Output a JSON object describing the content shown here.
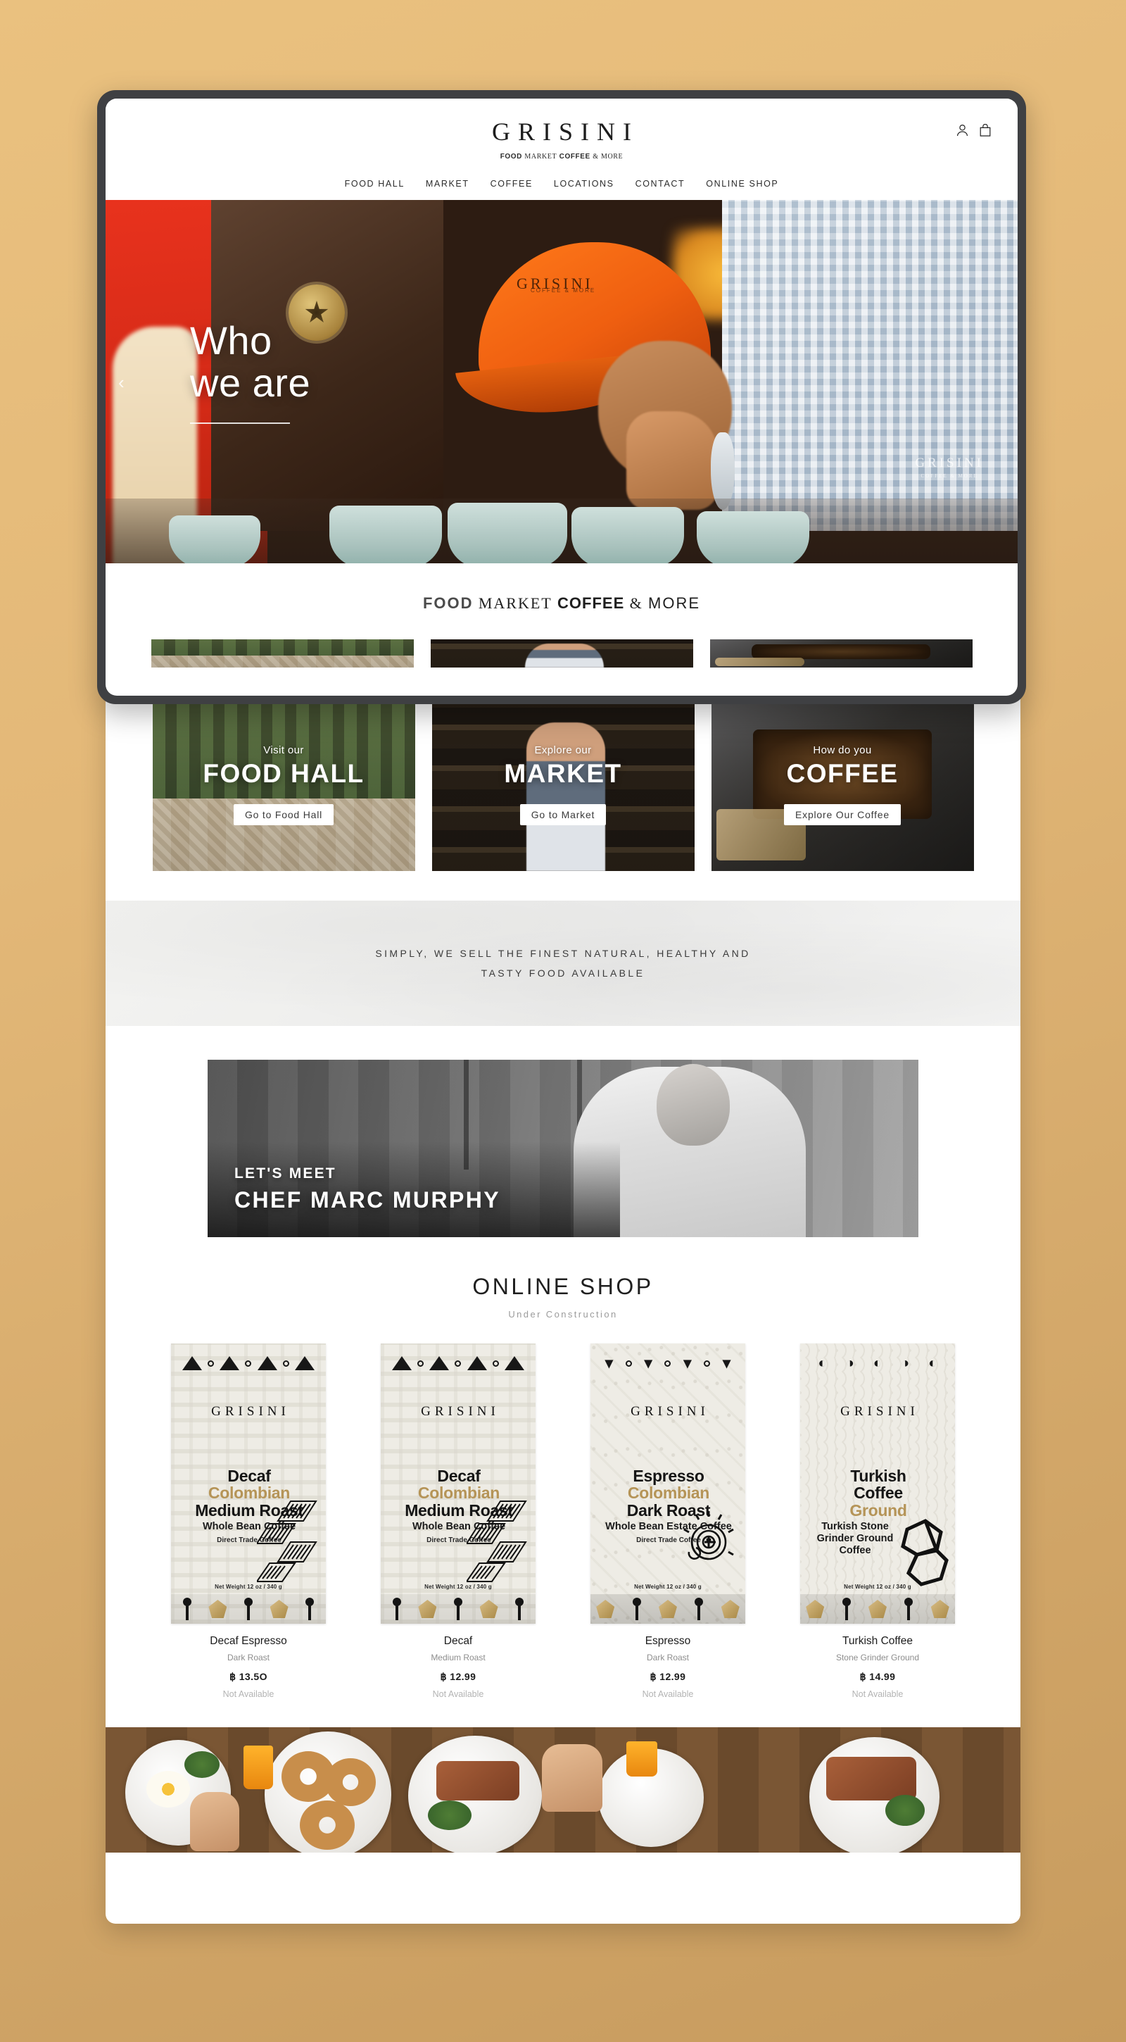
{
  "brand": {
    "logo": "GRISINI",
    "logo_letters": [
      "G",
      "R",
      "I",
      "S",
      "I",
      "N",
      "I"
    ],
    "tagline_parts": [
      {
        "text": "FOOD",
        "style": "bold"
      },
      {
        "text": "MARKET",
        "style": "serif"
      },
      {
        "text": "COFFEE",
        "style": "bold"
      },
      {
        "text": "&",
        "style": "serif"
      },
      {
        "text": "MORE",
        "style": "light"
      }
    ],
    "tagline_flat": "FOOD MARKET COFFEE & MORE"
  },
  "header": {
    "icons": [
      {
        "name": "account-icon",
        "label": "Account"
      },
      {
        "name": "shopping-bag-icon",
        "label": "Cart"
      }
    ],
    "nav": [
      {
        "label": "FOOD HALL"
      },
      {
        "label": "MARKET"
      },
      {
        "label": "COFFEE"
      },
      {
        "label": "LOCATIONS"
      },
      {
        "label": "CONTACT"
      },
      {
        "label": "ONLINE SHOP"
      }
    ]
  },
  "hero": {
    "line1": "Who",
    "line2": "we are",
    "prev_arrow": "‹",
    "cap_text": "GRISINI",
    "cap_sub": "COFFEE & MORE",
    "watermark": "GRISINI",
    "watermark_sub": "COFFEE & MORE"
  },
  "band_tagline": {
    "parts": [
      {
        "text": "FOOD",
        "style": "outline"
      },
      {
        "text": "MARKET",
        "style": "serif"
      },
      {
        "text": "COFFEE",
        "style": "bold"
      },
      {
        "text": "&",
        "style": "serif"
      },
      {
        "text": "MORE",
        "style": "light"
      }
    ]
  },
  "feature_cards": [
    {
      "kicker": "Visit our",
      "title": "FOOD HALL",
      "button": "Go to Food Hall",
      "photo": "food-hall-interior"
    },
    {
      "kicker": "Explore our",
      "title": "MARKET",
      "button": "Go to Market",
      "photo": "market-aisle-grocer"
    },
    {
      "kicker": "How do you",
      "title": "COFFEE",
      "button": "Explore Our Coffee",
      "photo": "coffee-roaster-beans"
    }
  ],
  "quote_band": {
    "line1": "SIMPLY, WE SELL THE FINEST NATURAL, HEALTHY AND",
    "line2": "TASTY FOOD AVAILABLE"
  },
  "chef_banner": {
    "kicker": "LET'S MEET",
    "name_part1": "C",
    "name": "CHEF MARC MURPHY",
    "photo": "chef-portrait-black-white"
  },
  "shop": {
    "title": "ONLINE SHOP",
    "subtitle": "Under Construction",
    "prev_arrow": "‹",
    "next_arrow": "›",
    "currency": "฿",
    "products": [
      {
        "name": "Decaf Espresso",
        "roast": "Dark Roast",
        "price": "฿ 13.5O",
        "stock": "Not Available",
        "bag": {
          "logo": "GRISINI",
          "line1": "Decaf",
          "line2": "Colombian",
          "line3": "Medium Roast",
          "line4": "Whole Bean Coffee",
          "line5": "Direct Trade Coffee",
          "weight": "Net Weight 12 oz / 340 g",
          "top_motif": "triangles-and-dots",
          "art_motif": "chevron-stripes"
        }
      },
      {
        "name": "Decaf",
        "roast": "Medium Roast",
        "price": "฿ 12.99",
        "stock": "Not Available",
        "bag": {
          "logo": "GRISINI",
          "line1": "Decaf",
          "line2": "Colombian",
          "line3": "Medium Roast",
          "line4": "Whole Bean Coffee",
          "line5": "Direct Trade Coffee",
          "weight": "Net Weight 12 oz / 340 g",
          "top_motif": "triangles-and-dots",
          "art_motif": "chevron-stripes"
        }
      },
      {
        "name": "Espresso",
        "roast": "Dark Roast",
        "price": "฿ 12.99",
        "stock": "Not Available",
        "bag": {
          "logo": "GRISINI",
          "line1": "Espresso",
          "line2": "Colombian",
          "line3": "Dark Roast",
          "line4": "Whole Bean Estate Coffee",
          "line5": "Direct Trade Coffee",
          "weight": "Net Weight 12 oz / 340 g",
          "top_motif": "crowns-and-dots",
          "art_motif": "spiral-sun"
        }
      },
      {
        "name": "Turkish Coffee",
        "roast": "Stone Grinder Ground",
        "price": "฿ 14.99",
        "stock": "Not Available",
        "bag": {
          "logo": "GRISINI",
          "line1": "Turkish",
          "line1b": "Coffee",
          "line2": "Ground",
          "line3": "",
          "line4": "Turkish Stone Grinder Ground Coffee",
          "line5": "",
          "weight": "Net Weight 12 oz / 340 g",
          "top_motif": "fans",
          "art_motif": "geometric-knot"
        }
      }
    ]
  },
  "food_strip": {
    "alt": "breakfast-table-spread"
  },
  "colors": {
    "page_background": "#e0b478",
    "device_bezel": "#3f4043",
    "text_primary": "#1c1c1c",
    "text_muted": "#9b9b9b",
    "gold_accent": "#b59457",
    "white": "#ffffff"
  }
}
